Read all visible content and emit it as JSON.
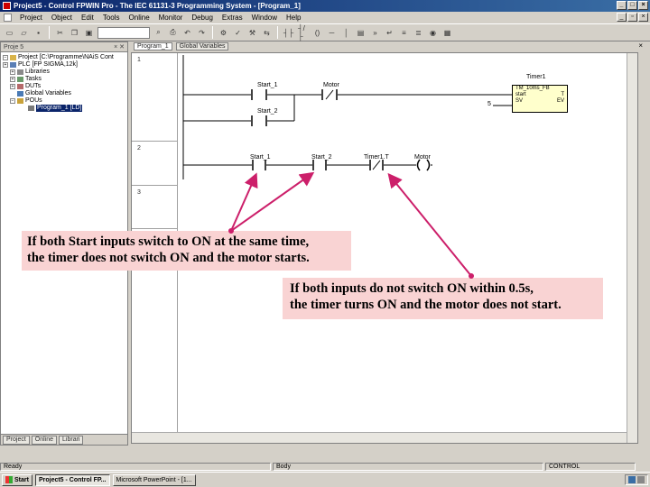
{
  "window": {
    "title": "Project5 - Control FPWIN Pro - The IEC 61131-3 Programming System - [Program_1]"
  },
  "menu": {
    "items": [
      "Project",
      "Object",
      "Edit",
      "Tools",
      "Online",
      "Monitor",
      "Debug",
      "Extras",
      "Window",
      "Help"
    ]
  },
  "project_pane": {
    "header": "Proje 5",
    "tree": [
      {
        "label": "Project [C:\\Programme\\NAiS Cont",
        "expander": "-",
        "level": 0
      },
      {
        "label": "PLC [FP SIGMA,12k]",
        "expander": "+",
        "level": 0
      },
      {
        "label": "Libraries",
        "expander": "+",
        "level": 1
      },
      {
        "label": "Tasks",
        "expander": "+",
        "level": 1
      },
      {
        "label": "DUTs",
        "expander": "+",
        "level": 1
      },
      {
        "label": "Global Variables",
        "expander": "",
        "level": 1
      },
      {
        "label": "POUs",
        "expander": "-",
        "level": 1
      },
      {
        "label": "Program_1 [LD]",
        "expander": "",
        "level": 2,
        "selected": true
      }
    ],
    "tabs": [
      "Project",
      "Online",
      "Librari"
    ]
  },
  "editor": {
    "tabs": [
      "Program_1",
      "Global Variables"
    ],
    "rung_numbers": [
      "1",
      "2",
      "3"
    ],
    "rung1": {
      "contact1": "Start_1",
      "contact2": "Start_2",
      "coil_contact": "Motor",
      "timer_instance": "Timer1",
      "timer_type": "TM_10ms_FB",
      "pins_left": [
        "start",
        "SV"
      ],
      "pins_right": [
        "T",
        "EV"
      ],
      "sv_value": "5"
    },
    "rung2": {
      "contact1": "Start_1",
      "contact2": "Start_2",
      "contact3": "Timer1.T",
      "coil": "Motor"
    }
  },
  "callouts": {
    "first_line1": "If both Start inputs switch to ON at the same time,",
    "first_line2": "the timer does not switch ON and the motor starts.",
    "second_line1": "If both inputs do not switch ON within 0.5s,",
    "second_line2": "the timer turns ON and the motor does not start."
  },
  "statusbar": {
    "ready": "Ready",
    "body": "Body",
    "mode": "CONTROL"
  },
  "taskbar": {
    "start": "Start",
    "tasks": [
      "Project5 - Control FP...",
      "Microsoft PowerPoint - [1..."
    ],
    "active_index": 0
  },
  "colors": {
    "callout_bg": "#f9d3d3",
    "arrow": "#cc1f6a",
    "titlebar": "#0a246a"
  }
}
